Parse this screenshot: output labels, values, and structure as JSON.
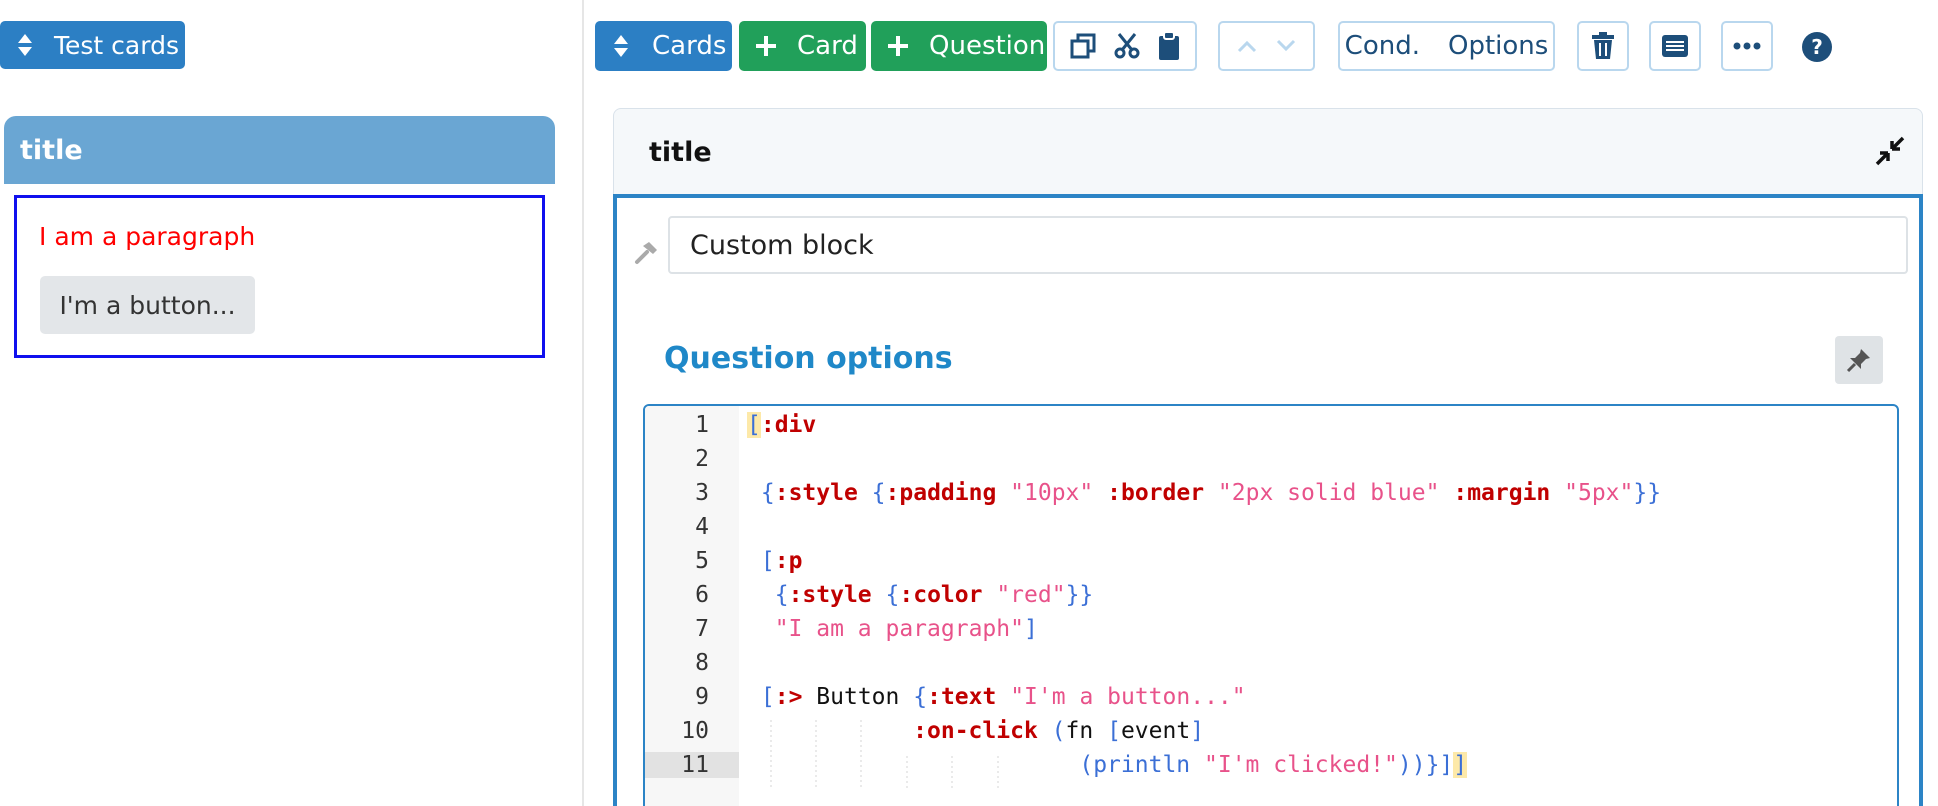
{
  "left_panel": {
    "test_cards_label": "Test cards",
    "card_title": "title",
    "preview": {
      "paragraph": "I am a paragraph",
      "button_label": "I'm a button..."
    }
  },
  "toolbar": {
    "cards_label": "Cards",
    "add_card_label": "Card",
    "add_question_label": "Question",
    "cond_label": "Cond.",
    "options_label": "Options",
    "help_label": "?"
  },
  "editor": {
    "title": "title",
    "block_type": "Custom block",
    "section_title": "Question options",
    "code_lines": [
      {
        "n": "1"
      },
      {
        "n": "2"
      },
      {
        "n": "3"
      },
      {
        "n": "4"
      },
      {
        "n": "5"
      },
      {
        "n": "6"
      },
      {
        "n": "7"
      },
      {
        "n": "8"
      },
      {
        "n": "9"
      },
      {
        "n": "10"
      },
      {
        "n": "11"
      }
    ],
    "code": {
      "l1_open": "[",
      "l1_kw": ":div",
      "l3_b1": "{",
      "l3_style": ":style",
      "l3_b2": "{",
      "l3_padding": ":padding",
      "l3_padding_val": "\"10px\"",
      "l3_border": ":border",
      "l3_border_val": "\"2px solid blue\"",
      "l3_margin": ":margin",
      "l3_margin_val": "\"5px\"",
      "l3_close": "}}",
      "l5_open": "[",
      "l5_kw": ":p",
      "l6_b1": "{",
      "l6_style": ":style",
      "l6_b2": "{",
      "l6_color": ":color",
      "l6_color_val": "\"red\"",
      "l6_close": "}}",
      "l7_str": "\"I am a paragraph\"",
      "l7_close": "]",
      "l9_open": "[",
      "l9_kw": ":>",
      "l9_sym": "Button",
      "l9_b": "{",
      "l9_text": ":text",
      "l9_text_val": "\"I'm a button...\"",
      "l10_kw": ":on-click",
      "l10_open": "(",
      "l10_fn": "fn",
      "l10_vec_open": "[",
      "l10_arg": "event",
      "l10_vec_close": "]",
      "l11_open": "(",
      "l11_fn": "println",
      "l11_str": "\"I'm clicked!\"",
      "l11_close": "))}]",
      "l11_last": "]"
    }
  },
  "colors": {
    "primary": "#2c7fc4",
    "success": "#21a05a",
    "preview_border": "#1010ee",
    "paragraph": "#ff0000",
    "section_title": "#1f88c8"
  },
  "icons": {
    "sort": "sort-icon",
    "plus": "plus-icon",
    "copy": "copy-icon",
    "cut": "scissors-icon",
    "paste": "clipboard-icon",
    "up": "chevron-up-icon",
    "down": "chevron-down-icon",
    "trash": "trash-icon",
    "list": "list-icon",
    "more": "ellipsis-icon",
    "help": "question-circle-icon",
    "collapse": "compress-icon",
    "hammer": "hammer-icon",
    "pin": "pin-icon"
  }
}
